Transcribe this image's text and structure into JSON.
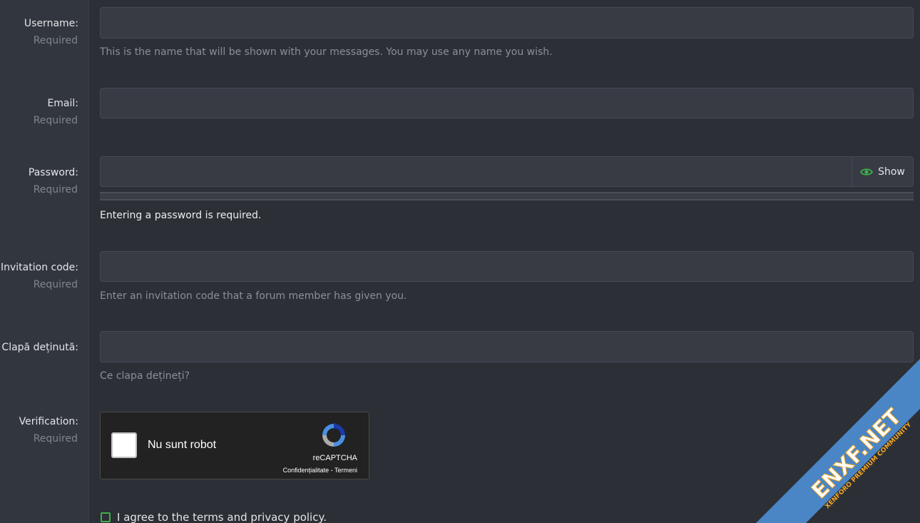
{
  "fields": {
    "username": {
      "label": "Username:",
      "required": "Required",
      "value": "",
      "hint": "This is the name that will be shown with your messages. You may use any name you wish."
    },
    "email": {
      "label": "Email:",
      "required": "Required",
      "value": ""
    },
    "password": {
      "label": "Password:",
      "required": "Required",
      "value": "",
      "show_label": "Show",
      "error": "Entering a password is required."
    },
    "invitation": {
      "label": "Invitation code:",
      "required": "Required",
      "value": "",
      "hint": "Enter an invitation code that a forum member has given you."
    },
    "clapa": {
      "label": "Clapă deținută:",
      "value": "",
      "hint": "Ce clapa dețineți?"
    },
    "verification": {
      "label": "Verification:",
      "required": "Required"
    }
  },
  "captcha": {
    "checkbox_label": "Nu sunt robot",
    "brand": "reCAPTCHA",
    "links": "Confidențialitate - Termeni"
  },
  "agree": {
    "label": "I agree to the terms and privacy policy."
  },
  "watermark": {
    "brand": "ENXF.NET",
    "tagline": "XENFORO PREMIUM COMMUNITY"
  },
  "colors": {
    "background": "#2c2f36",
    "accent_green": "#3fae49",
    "ribbon": "#4a86c5",
    "watermark_orange": "#f5a623"
  }
}
